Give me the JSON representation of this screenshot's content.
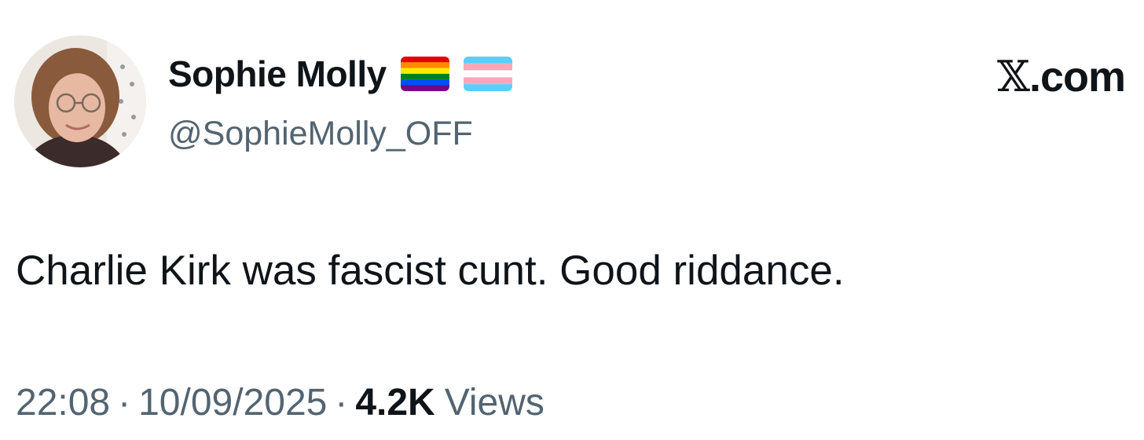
{
  "user": {
    "display_name": "Sophie Molly",
    "handle": "@SophieMolly_OFF",
    "avatar_icon": "profile-photo",
    "flags": [
      "rainbow-pride-flag-icon",
      "transgender-pride-flag-icon"
    ]
  },
  "brand": {
    "x_glyph": "𝕏",
    "domain": ".com"
  },
  "tweet": {
    "text": "Charlie Kirk was fascist cunt. Good riddance.",
    "time": "22:08",
    "date": "10/09/2025",
    "separator": "·",
    "views_count": "4.2K",
    "views_label": "Views"
  },
  "colors": {
    "primary_text": "#0f1419",
    "secondary_text": "#536471"
  }
}
